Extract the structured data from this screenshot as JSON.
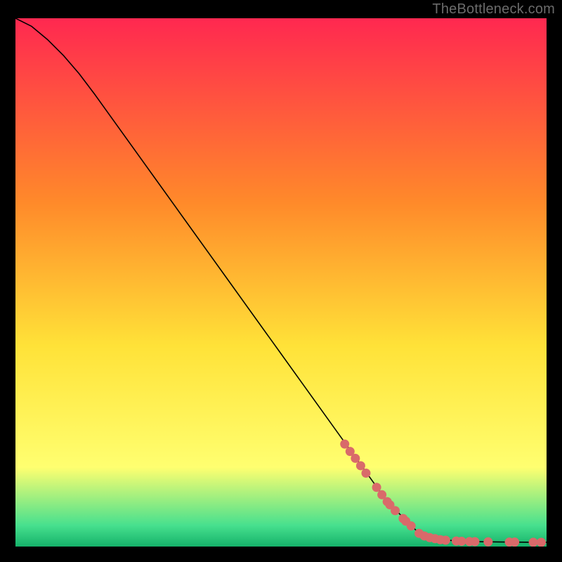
{
  "watermark": "TheBottleneck.com",
  "colors": {
    "gradient_top": "#ff2850",
    "gradient_mid1": "#ff8a2a",
    "gradient_mid2": "#ffe238",
    "gradient_mid3": "#ffff70",
    "gradient_green": "#47e08e",
    "gradient_bottom": "#15b26a",
    "line": "#000000",
    "marker": "#d96a6a",
    "background": "#000000"
  },
  "chart_data": {
    "type": "line",
    "title": "",
    "xlabel": "",
    "ylabel": "",
    "xlim": [
      0,
      100
    ],
    "ylim": [
      0,
      100
    ],
    "series": [
      {
        "name": "curve",
        "x": [
          0,
          3,
          6,
          9,
          12,
          15,
          20,
          30,
          40,
          50,
          60,
          70,
          76,
          80,
          84,
          88,
          92,
          96,
          100
        ],
        "y": [
          100,
          98.5,
          96,
          93,
          89.5,
          85.5,
          78.5,
          64.5,
          50.5,
          36.5,
          22.5,
          8.5,
          2.5,
          1.3,
          1.0,
          0.9,
          0.85,
          0.82,
          0.8
        ]
      }
    ],
    "markers": {
      "name": "highlighted-points",
      "x": [
        62,
        63,
        64,
        65,
        66,
        68,
        69,
        70,
        70.5,
        71.5,
        73,
        73.5,
        74.5,
        76,
        77,
        78,
        79,
        80,
        81,
        83,
        84,
        85.5,
        86.5,
        89,
        93,
        94,
        97.5,
        99
      ],
      "y": [
        19.4,
        18.0,
        16.7,
        15.3,
        13.9,
        11.2,
        9.8,
        8.5,
        7.9,
        6.8,
        5.3,
        4.8,
        3.9,
        2.5,
        2.0,
        1.7,
        1.5,
        1.3,
        1.2,
        1.05,
        1.0,
        0.95,
        0.93,
        0.89,
        0.85,
        0.84,
        0.81,
        0.8
      ]
    }
  }
}
